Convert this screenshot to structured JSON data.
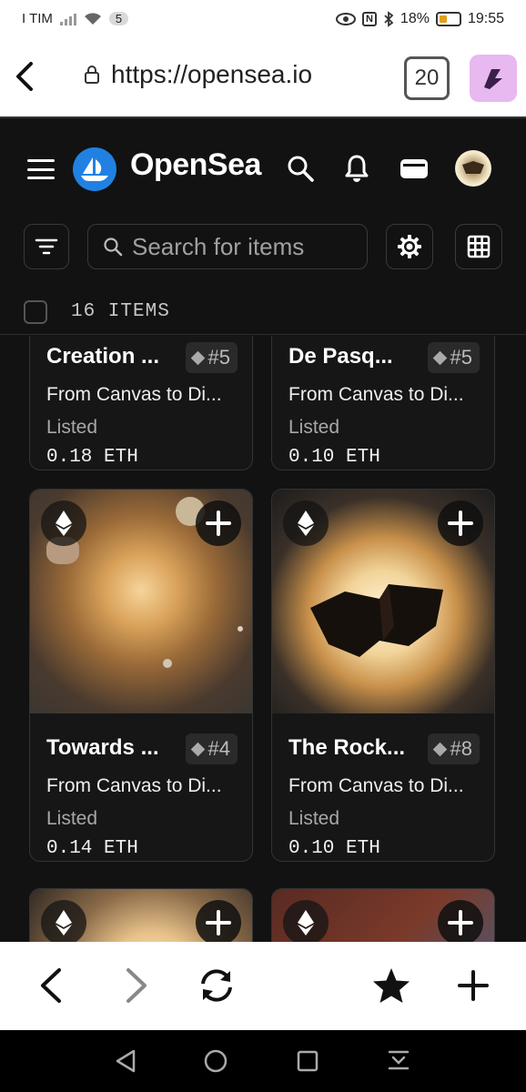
{
  "status_bar": {
    "carrier": "I TIM",
    "notification_count": "5",
    "battery": "18%",
    "time": "19:55"
  },
  "browser": {
    "url": "https://opensea.io",
    "tab_count": "20"
  },
  "opensea": {
    "brand": "OpenSea",
    "search_placeholder": "Search for items",
    "items_count": "16 ITEMS"
  },
  "cards": [
    {
      "title": "Creation ...",
      "tag": "#5",
      "collection": "From Canvas to Di...",
      "status": "Listed",
      "price": "0.18 ETH"
    },
    {
      "title": "De Pasq...",
      "tag": "#5",
      "collection": "From Canvas to Di...",
      "status": "Listed",
      "price": "0.10 ETH"
    },
    {
      "title": "Towards ...",
      "tag": "#4",
      "collection": "From Canvas to Di...",
      "status": "Listed",
      "price": "0.14 ETH"
    },
    {
      "title": "The Rock...",
      "tag": "#8",
      "collection": "From Canvas to Di...",
      "status": "Listed",
      "price": "0.10 ETH"
    }
  ],
  "colors": {
    "background": "#121212",
    "opensea_blue": "#2081e2",
    "extension_pink": "#e8b8f0"
  },
  "icons": [
    "back-arrow-icon",
    "lock-icon",
    "hamburger-icon",
    "opensea-logo-icon",
    "search-icon",
    "bell-icon",
    "wallet-icon",
    "filter-icon",
    "gear-icon",
    "grid-icon",
    "ethereum-icon",
    "plus-icon",
    "forward-arrow-icon",
    "refresh-icon",
    "star-icon",
    "new-tab-icon"
  ]
}
